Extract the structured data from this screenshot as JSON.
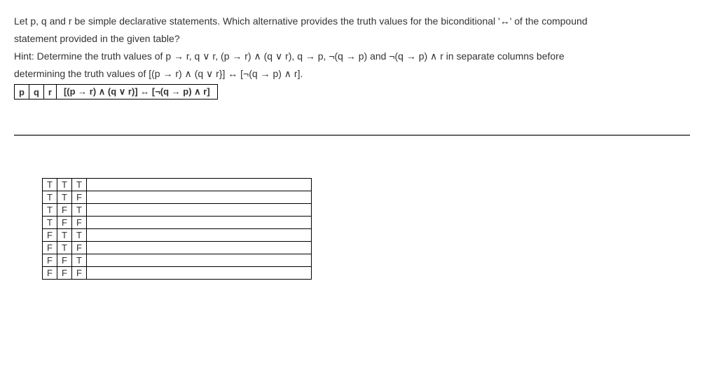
{
  "question": {
    "line1": "Let p, q and r be simple declarative statements. Which alternative provides the truth values for the biconditional '↔' of the compound",
    "line2": "statement provided in the given table?",
    "hint1": "Hint: Determine the truth values of p → r, q ∨ r, (p  → r) ∧ (q ∨ r), q  → p, ¬(q  → p) and ¬(q  → p) ∧ r in separate columns before",
    "hint2": "determining the truth values of [(p  → r) ∧ (q ∨ r}] ↔  [¬(q  → p) ∧ r]."
  },
  "header_row": {
    "p": "p",
    "q": "q",
    "r": "r",
    "formula": "[(p → r) ∧ (q ∨ r)] ↔ [¬(q → p) ∧ r]"
  },
  "truth_rows": [
    {
      "p": "T",
      "q": "T",
      "r": "T",
      "result": ""
    },
    {
      "p": "T",
      "q": "T",
      "r": "F",
      "result": ""
    },
    {
      "p": "T",
      "q": "F",
      "r": "T",
      "result": ""
    },
    {
      "p": "T",
      "q": "F",
      "r": "F",
      "result": ""
    },
    {
      "p": "F",
      "q": "T",
      "r": "T",
      "result": ""
    },
    {
      "p": "F",
      "q": "T",
      "r": "F",
      "result": ""
    },
    {
      "p": "F",
      "q": "F",
      "r": "T",
      "result": ""
    },
    {
      "p": "F",
      "q": "F",
      "r": "F",
      "result": ""
    }
  ]
}
